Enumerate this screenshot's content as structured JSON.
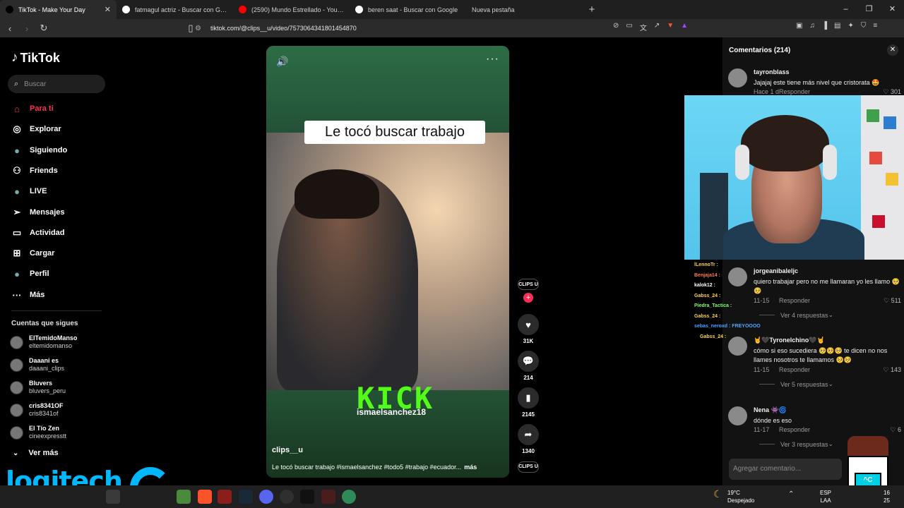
{
  "browser": {
    "tabs": [
      {
        "label": "TikTok - Make Your Day",
        "icon": "tiktok-icon",
        "color": "#000000",
        "active": true
      },
      {
        "label": "fatmagul actriz - Buscar con Google",
        "icon": "google-icon",
        "color": "#ffffff",
        "active": false
      },
      {
        "label": "(2590) Mundo Estrellado - YouTube",
        "icon": "youtube-icon",
        "color": "#ff0000",
        "active": false
      },
      {
        "label": "beren saat - Buscar con Google",
        "icon": "google-icon",
        "color": "#ffffff",
        "active": false
      },
      {
        "label": "Nueva pestaña",
        "icon": "",
        "color": "",
        "active": false
      }
    ],
    "new_tab_glyph": "+",
    "url": "tiktok.com/@clips__u/video/7573064341801454870"
  },
  "sidebar": {
    "brand": "TikTok",
    "search_placeholder": "Buscar",
    "nav": [
      {
        "label": "Para ti",
        "icon": "home-icon",
        "glyph": "⌂",
        "active": true
      },
      {
        "label": "Explorar",
        "icon": "compass-icon",
        "glyph": "◎",
        "active": false
      },
      {
        "label": "Siguiendo",
        "icon": "following-avatar-icon",
        "glyph": "●",
        "active": false
      },
      {
        "label": "Friends",
        "icon": "friends-icon",
        "glyph": "⚇",
        "active": false
      },
      {
        "label": "LIVE",
        "icon": "live-avatar-icon",
        "glyph": "●",
        "active": false
      },
      {
        "label": "Mensajes",
        "icon": "send-icon",
        "glyph": "➢",
        "active": false
      },
      {
        "label": "Actividad",
        "icon": "activity-icon",
        "glyph": "▭",
        "active": false
      },
      {
        "label": "Cargar",
        "icon": "upload-icon",
        "glyph": "⊞",
        "active": false
      },
      {
        "label": "Perfil",
        "icon": "profile-avatar-icon",
        "glyph": "●",
        "active": false
      },
      {
        "label": "Más",
        "icon": "more-icon",
        "glyph": "···",
        "active": false
      }
    ],
    "following_title": "Cuentas que sigues",
    "following": [
      {
        "name": "ElTemidoManso",
        "handle": "eltemidomanso"
      },
      {
        "name": "Daaani es",
        "handle": "daaani_clips"
      },
      {
        "name": "Bluvers",
        "handle": "bluvers_peru"
      },
      {
        "name": "cris8341OF",
        "handle": "cris8341of"
      },
      {
        "name": "El Tío Zen",
        "handle": "cineexpresstt"
      }
    ],
    "see_more": "Ver más"
  },
  "overlay": {
    "brand": "logitech"
  },
  "video": {
    "banner": "Le tocó buscar trabajo",
    "kick_logo": "KICK",
    "kick_user": "ismaelsanchez18",
    "author": "clips__u",
    "description": "Le tocó buscar trabajo #ismaelsanchez #todo5 #trabajo #ecuador...",
    "more": "más"
  },
  "actions": {
    "creator_badge": "CLIPS U",
    "likes": "31K",
    "comments": "214",
    "saves": "2145",
    "shares": "1340"
  },
  "comments_panel": {
    "title": "Comentarios (214)",
    "placeholder": "Agregar comentario...",
    "items": [
      {
        "user": "tayronblass",
        "text": "Jajajaj este tiene más nivel que cristorata 🤩",
        "time": "Hace 1 d",
        "reply": "Responder",
        "likes": "301",
        "more": ""
      },
      {
        "user": "jorgeanibaleljc",
        "text": "quiero trabajar pero no me llamaran yo les llamo 🥺🥺",
        "time": "11-15",
        "reply": "Responder",
        "likes": "511",
        "more": "Ver 4 respuestas"
      },
      {
        "user": "🤘🖤Tyronelchino🖤🤘",
        "text": "cómo si eso sucediera 🥺🥺🥺 te dicen no nos llames nosotros te llamamos 🥺🥺",
        "time": "11-15",
        "reply": "Responder",
        "likes": "143",
        "more": "Ver 5 respuestas"
      },
      {
        "user": "Nena 👾🌀",
        "text": "dónde es eso",
        "time": "11-17",
        "reply": "Responder",
        "likes": "6",
        "more": "Ver 3 respuestas"
      }
    ]
  },
  "stream_chat": [
    {
      "user": "lLennoTr :",
      "color": "#ffd43b"
    },
    {
      "user": "Benjaja14 :",
      "color": "#ff7b54"
    },
    {
      "user": "kalok12 :",
      "color": "#ffffff"
    },
    {
      "user": "Gabss_24 :",
      "color": "#ffd43b"
    },
    {
      "user": "Piedra_Tactica :",
      "color": "#7dff6f"
    },
    {
      "user": "Gabss_24 :",
      "color": "#ffd43b"
    },
    {
      "user": "sebas_neroxd : FREYOOOO",
      "color": "#4da6ff"
    },
    {
      "user": "Gabss_24 :",
      "color": "#ffd43b"
    }
  ],
  "taskbar": {
    "temperature": "19°C",
    "weather": "Despejado",
    "lang1": "ESP",
    "lang2": "LAA",
    "time1": "16",
    "time2": "25"
  },
  "colors": {
    "accent": "#fe2c55",
    "kick": "#53fc18",
    "logitech": "#00b8fc"
  }
}
